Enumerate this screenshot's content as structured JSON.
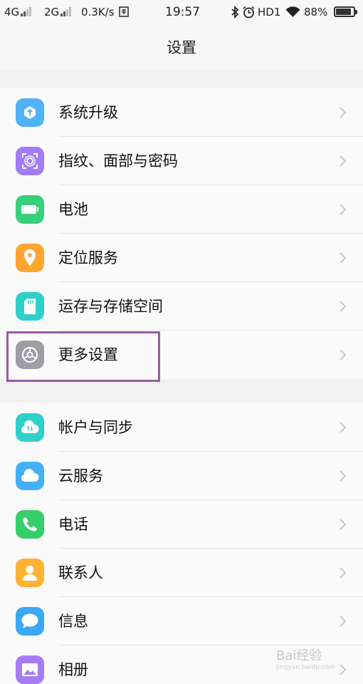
{
  "status_bar": {
    "net1": "4G",
    "net2": "2G",
    "speed": "0.3K/s",
    "time": "19:57",
    "hd": "HD1",
    "battery": "88%",
    "battery_level": 0.88
  },
  "header": {
    "title": "设置"
  },
  "group1": {
    "items": [
      {
        "label": "系统升级",
        "icon": "system-update-icon",
        "color": "#4fb3f5"
      },
      {
        "label": "指纹、面部与密码",
        "icon": "fingerprint-icon",
        "color": "#a27cf5"
      },
      {
        "label": "电池",
        "icon": "battery-icon",
        "color": "#36d07a"
      },
      {
        "label": "定位服务",
        "icon": "location-pin-icon",
        "color": "#ffa532"
      },
      {
        "label": "运存与存储空间",
        "icon": "sd-card-icon",
        "color": "#2fd0c9"
      },
      {
        "label": "更多设置",
        "icon": "gear-icon",
        "color": "#9e9ea6"
      }
    ]
  },
  "group2": {
    "items": [
      {
        "label": "帐户与同步",
        "icon": "cloud-sync-icon",
        "color": "#2fd0c9"
      },
      {
        "label": "云服务",
        "icon": "cloud-icon",
        "color": "#43b0f5"
      },
      {
        "label": "电话",
        "icon": "phone-icon",
        "color": "#35cf6a"
      },
      {
        "label": "联系人",
        "icon": "contact-icon",
        "color": "#ffb234"
      },
      {
        "label": "信息",
        "icon": "message-icon",
        "color": "#3aa8f3"
      },
      {
        "label": "相册",
        "icon": "gallery-icon",
        "color": "#a77cf2"
      }
    ]
  },
  "watermark": {
    "text": "Bai经验",
    "sub": "jingyan.baidu.com"
  }
}
